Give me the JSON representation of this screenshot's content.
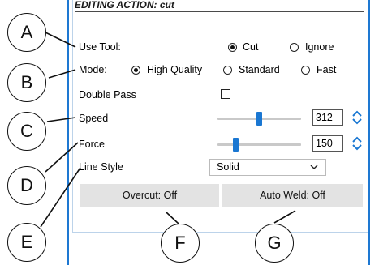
{
  "header": {
    "title": "EDITING ACTION: cut"
  },
  "use_tool": {
    "label": "Use Tool:",
    "options": [
      "Cut",
      "Ignore"
    ],
    "selected": "Cut"
  },
  "mode": {
    "label": "Mode:",
    "options": [
      "High Quality",
      "Standard",
      "Fast"
    ],
    "selected": "High Quality"
  },
  "double_pass": {
    "label": "Double Pass",
    "checked": false
  },
  "speed": {
    "label": "Speed",
    "value": "312",
    "slider_fraction": 0.5
  },
  "force": {
    "label": "Force",
    "value": "150",
    "slider_fraction": 0.2
  },
  "line_style": {
    "label": "Line Style",
    "selected": "Solid"
  },
  "buttons": {
    "overcut": "Overcut: Off",
    "auto_weld": "Auto Weld: Off"
  },
  "callouts": [
    "A",
    "B",
    "C",
    "D",
    "E",
    "F",
    "G"
  ],
  "colors": {
    "accent": "#1a77d2",
    "button_bg": "#e3e3e3"
  }
}
